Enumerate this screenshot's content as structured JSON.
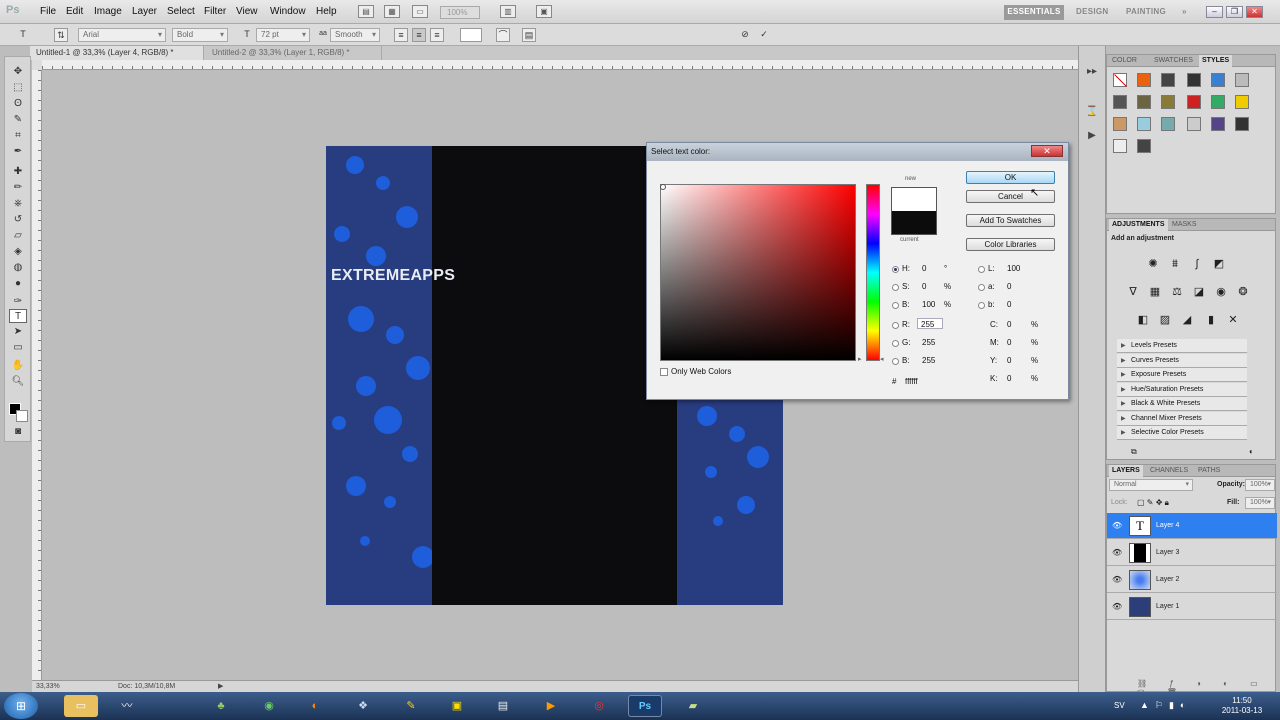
{
  "app": {
    "logo": "Ps"
  },
  "menus": [
    "File",
    "Edit",
    "Image",
    "Layer",
    "Select",
    "Filter",
    "View",
    "Window",
    "Help"
  ],
  "menubar": {
    "zoom": "100%"
  },
  "workspaces": {
    "active": "ESSENTIALS",
    "design": "DESIGN",
    "painting": "PAINTING",
    "more": "»"
  },
  "options_bar": {
    "font_family": "Arial",
    "font_style": "Bold",
    "font_size": "72 pt",
    "antialias": "Smooth"
  },
  "doc_tabs": [
    {
      "label": "Untitled-1 @ 33,3% (Layer 4, RGB/8) *"
    },
    {
      "label": "Untitled-2 @ 33,3% (Layer 1, RGB/8) *"
    }
  ],
  "canvas": {
    "text": "EXTREMEAPPS"
  },
  "status": {
    "zoom": "33,33%",
    "doc": "Doc: 10,3M/10,8M"
  },
  "panels": {
    "color_tabs": [
      "COLOR",
      "SWATCHES",
      "STYLES"
    ],
    "adjustments_tabs": [
      "ADJUSTMENTS",
      "MASKS"
    ],
    "adjustments_title": "Add an adjustment",
    "presets": [
      "Levels Presets",
      "Curves Presets",
      "Exposure Presets",
      "Hue/Saturation Presets",
      "Black & White Presets",
      "Channel Mixer Presets",
      "Selective Color Presets"
    ],
    "layers_tabs": [
      "LAYERS",
      "CHANNELS",
      "PATHS"
    ],
    "blend_mode": "Normal",
    "opacity_label": "Opacity:",
    "opacity": "100%",
    "lock_label": "Lock:",
    "fill_label": "Fill:",
    "fill": "100%",
    "layers": [
      {
        "name": "Layer 4",
        "active": true
      },
      {
        "name": "Layer 3"
      },
      {
        "name": "Layer 2"
      },
      {
        "name": "Layer 1"
      }
    ]
  },
  "dialog": {
    "title": "Select text color:",
    "new_label": "new",
    "current_label": "current",
    "buttons": {
      "ok": "OK",
      "cancel": "Cancel",
      "add_swatches": "Add To Swatches",
      "libraries": "Color Libraries"
    },
    "hsb": {
      "h_label": "H:",
      "h": "0",
      "h_unit": "°",
      "s_label": "S:",
      "s": "0",
      "s_unit": "%",
      "b_label": "B:",
      "b": "100",
      "b_unit": "%"
    },
    "rgb": {
      "r_label": "R:",
      "r": "255",
      "g_label": "G:",
      "g": "255",
      "b_label": "B:",
      "b": "255"
    },
    "lab": {
      "l_label": "L:",
      "l": "100",
      "a_label": "a:",
      "a": "0",
      "b_label": "b:",
      "b": "0"
    },
    "cmyk": {
      "c_label": "C:",
      "c": "0",
      "m_label": "M:",
      "m": "0",
      "y_label": "Y:",
      "y": "0",
      "k_label": "K:",
      "k": "0",
      "unit": "%"
    },
    "hex_label": "#",
    "hex": "ffffff",
    "web_colors": "Only Web Colors",
    "colors": {
      "new": "#ffffff",
      "current": "#0c0c0c"
    }
  },
  "taskbar": {
    "lang": "SV",
    "time": "11:50",
    "date": "2011-03-13"
  }
}
